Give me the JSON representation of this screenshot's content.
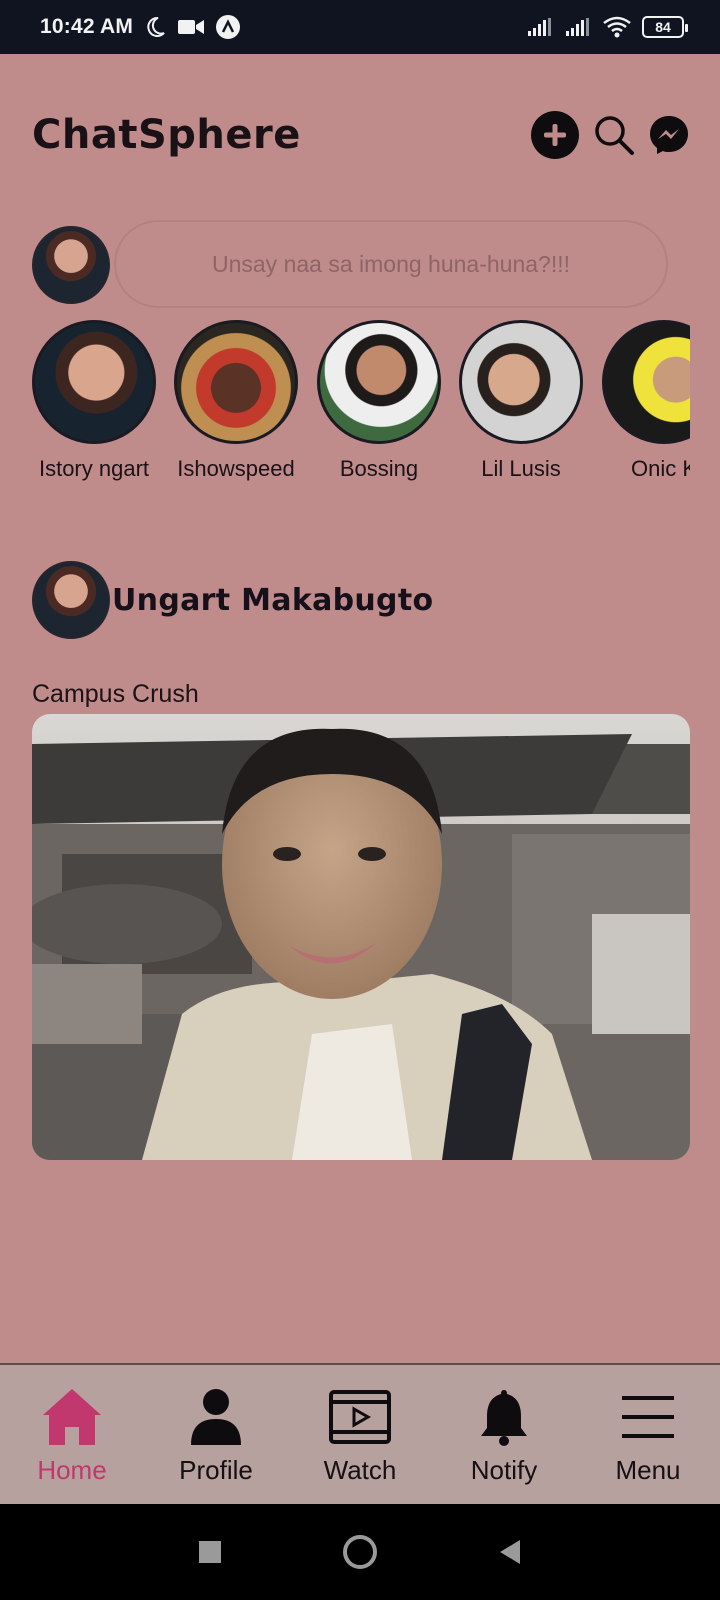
{
  "status_bar": {
    "time": "10:42 AM",
    "battery": "84",
    "icons": [
      "moon-icon",
      "video-camera-icon",
      "app-notification-icon",
      "signal-icon",
      "signal-icon",
      "wifi-icon",
      "battery-icon"
    ]
  },
  "header": {
    "title": "ChatSphere",
    "actions": [
      "add-icon",
      "search-icon",
      "messenger-icon"
    ]
  },
  "composer": {
    "placeholder": "Unsay naa sa imong huna-huna?!!!"
  },
  "stories": [
    {
      "name": "Istory ngart"
    },
    {
      "name": "Ishowspeed"
    },
    {
      "name": "Bossing"
    },
    {
      "name": "Lil Lusis"
    },
    {
      "name": "Onic K"
    }
  ],
  "post": {
    "author": "Ungart Makabugto",
    "caption": "Campus Crush"
  },
  "nav": {
    "items": [
      {
        "label": "Home",
        "icon": "home-icon",
        "active": true
      },
      {
        "label": "Profile",
        "icon": "profile-icon",
        "active": false
      },
      {
        "label": "Watch",
        "icon": "watch-icon",
        "active": false
      },
      {
        "label": "Notify",
        "icon": "bell-icon",
        "active": false
      },
      {
        "label": "Menu",
        "icon": "menu-icon",
        "active": false
      }
    ]
  },
  "colors": {
    "background": "#c08b8b",
    "status_bar": "#101421",
    "nav_bar": "#b7a19f",
    "accent": "#c0386d"
  }
}
